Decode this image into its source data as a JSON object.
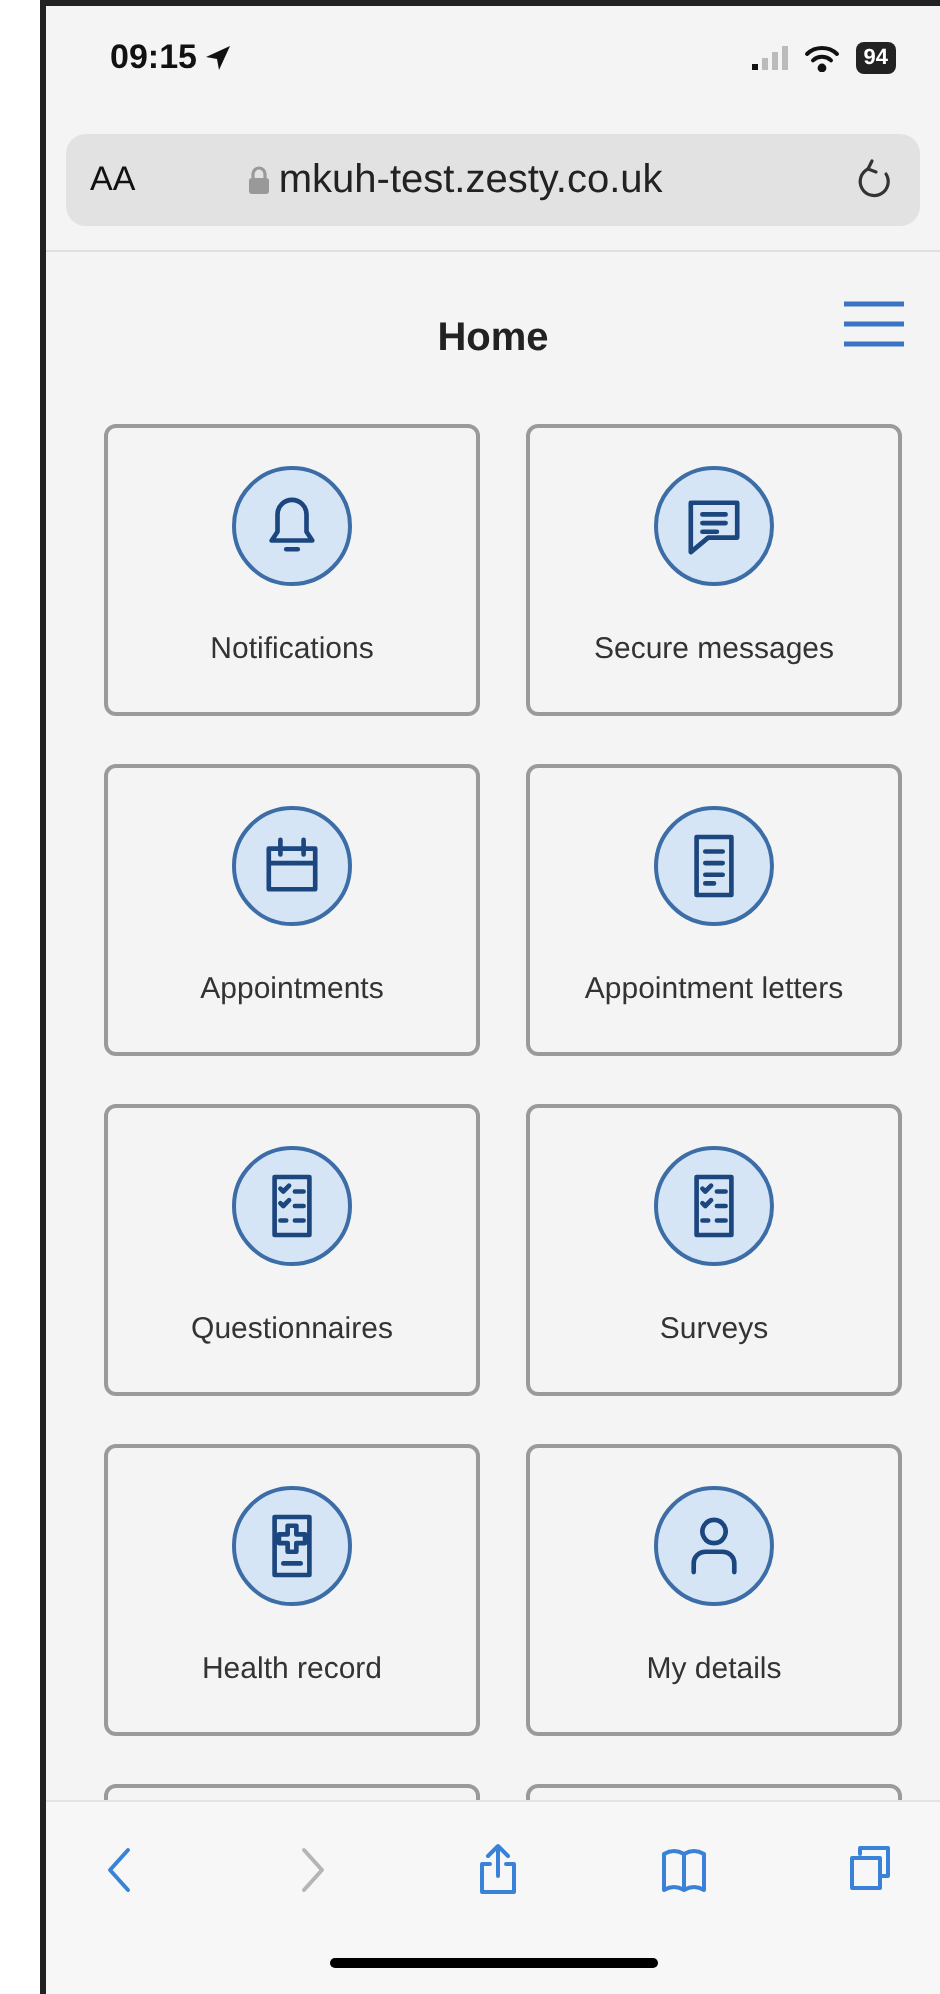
{
  "status_bar": {
    "time": "09:15",
    "battery": "94"
  },
  "address_bar": {
    "text_size": "AA",
    "url": "mkuh-test.zesty.co.uk"
  },
  "header": {
    "title": "Home"
  },
  "tiles": [
    {
      "label": "Notifications",
      "kind": "bell"
    },
    {
      "label": "Secure messages",
      "kind": "message"
    },
    {
      "label": "Appointments",
      "kind": "calendar"
    },
    {
      "label": "Appointment letters",
      "kind": "document"
    },
    {
      "label": "Questionnaires",
      "kind": "checklist"
    },
    {
      "label": "Surveys",
      "kind": "checklist"
    },
    {
      "label": "Health record",
      "kind": "medical"
    },
    {
      "label": "My details",
      "kind": "person"
    },
    {
      "kind": "partial"
    },
    {
      "kind": "partial"
    }
  ],
  "toolbar": [
    {
      "kind": "back",
      "disabled": false
    },
    {
      "kind": "forward",
      "disabled": true
    },
    {
      "kind": "share",
      "disabled": false
    },
    {
      "kind": "bookmarks",
      "disabled": false
    },
    {
      "kind": "tabs",
      "disabled": false
    }
  ]
}
